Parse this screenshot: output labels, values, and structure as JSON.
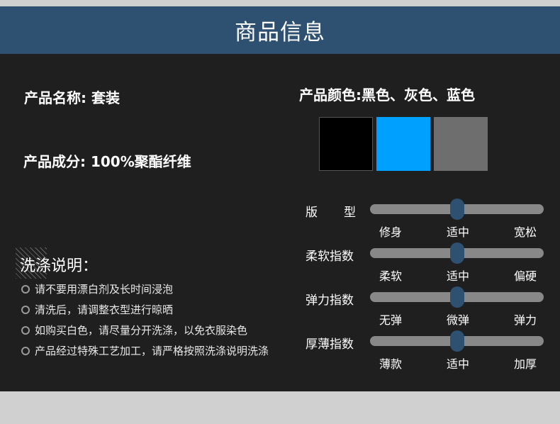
{
  "header": {
    "title": "商品信息"
  },
  "product": {
    "name_label": "产品名称: 套装",
    "composition_label": "产品成分: 100%聚酯纤维",
    "colors_label": "产品颜色:黑色、灰色、蓝色",
    "swatch_colors": [
      "#000000",
      "#00a0ff",
      "#6e6e6f"
    ]
  },
  "washing": {
    "title": "洗涤说明：",
    "items": [
      "请不要用漂白剂及长时间浸泡",
      "清洗后，请调整衣型进行晾晒",
      "如购买白色，请尽量分开洗涤，以免衣服染色",
      "产品经过特殊工艺加工，请严格按照洗涤说明洗涤"
    ]
  },
  "sliders": [
    {
      "label_a": "版",
      "label_b": "型",
      "ticks": [
        "修身",
        "适中",
        "宽松"
      ],
      "value": 0.5
    },
    {
      "label": "柔软指数",
      "ticks": [
        "柔软",
        "适中",
        "偏硬"
      ],
      "value": 0.5
    },
    {
      "label": "弹力指数",
      "ticks": [
        "无弹",
        "微弹",
        "弹力"
      ],
      "value": 0.5
    },
    {
      "label": "厚薄指数",
      "ticks": [
        "薄款",
        "适中",
        "加厚"
      ],
      "value": 0.5
    }
  ],
  "colors": {
    "header_bg": "#2e5071",
    "panel_bg": "#1f1f1f",
    "knob": "#2e5071",
    "track": "#888888"
  }
}
